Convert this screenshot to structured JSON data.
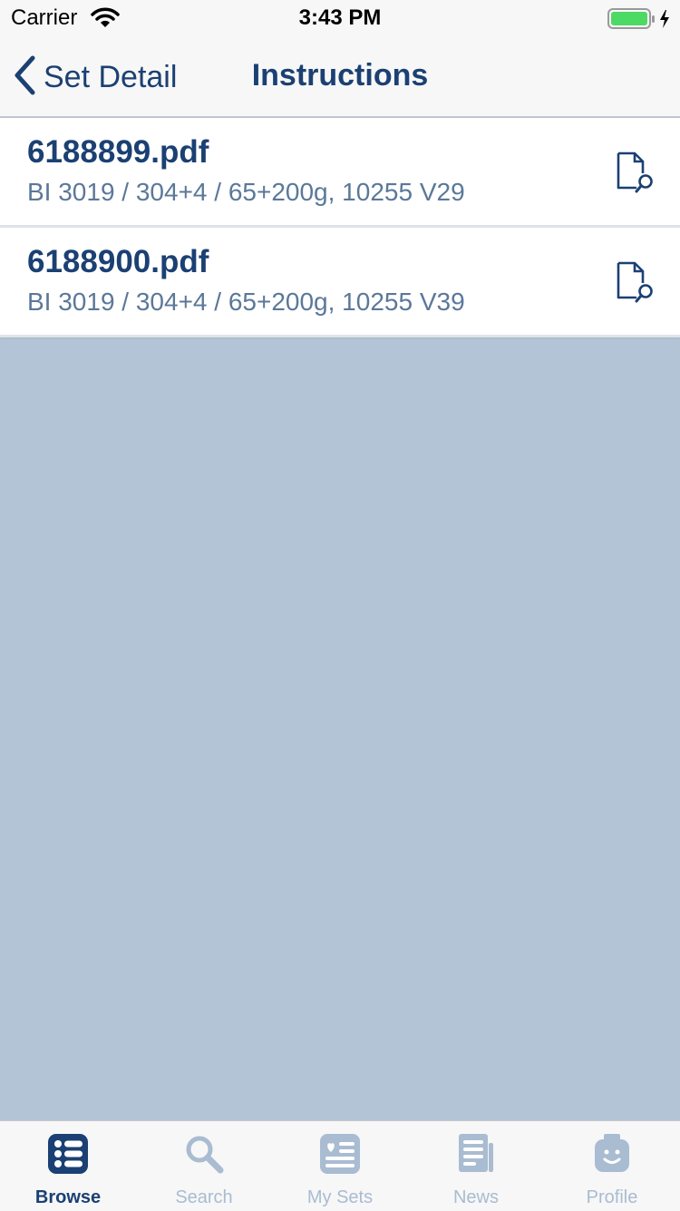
{
  "status_bar": {
    "carrier": "Carrier",
    "time": "3:43 PM"
  },
  "nav": {
    "back_label": "Set Detail",
    "title": "Instructions"
  },
  "instructions": [
    {
      "filename": "6188899.pdf",
      "details": "BI 3019 / 304+4 / 65+200g, 10255 V29",
      "icon": "document-search-icon"
    },
    {
      "filename": "6188900.pdf",
      "details": "BI 3019 / 304+4 / 65+200g, 10255 V39",
      "icon": "document-search-icon"
    }
  ],
  "tabs": [
    {
      "label": "Browse",
      "icon": "browse-list-icon",
      "active": true
    },
    {
      "label": "Search",
      "icon": "search-icon",
      "active": false
    },
    {
      "label": "My Sets",
      "icon": "my-sets-icon",
      "active": false
    },
    {
      "label": "News",
      "icon": "news-icon",
      "active": false
    },
    {
      "label": "Profile",
      "icon": "profile-minifig-icon",
      "active": false
    }
  ],
  "colors": {
    "accent": "#1b4073",
    "subtitle": "#5b7899",
    "background": "#b3c4d6",
    "tab_inactive": "#a9bcd1",
    "battery": "#4cd964"
  }
}
